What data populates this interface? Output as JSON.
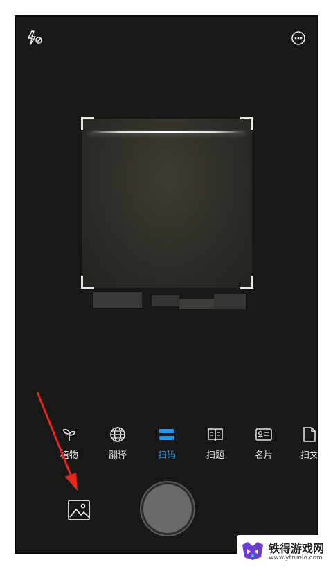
{
  "modes": [
    {
      "label": "植物",
      "icon": "sprout-icon",
      "active": false
    },
    {
      "label": "翻译",
      "icon": "globe-icon",
      "active": false
    },
    {
      "label": "扫码",
      "icon": "scan-code-icon",
      "active": true
    },
    {
      "label": "扫题",
      "icon": "book-icon",
      "active": false
    },
    {
      "label": "名片",
      "icon": "business-card-icon",
      "active": false
    },
    {
      "label": "扫文",
      "icon": "document-icon",
      "active": false
    }
  ],
  "colors": {
    "active": "#2196f3",
    "background": "#181816",
    "annotation_arrow": "#e8231e"
  },
  "watermark": {
    "name": "铁得游戏网",
    "url": "www.ytruolo.com"
  }
}
